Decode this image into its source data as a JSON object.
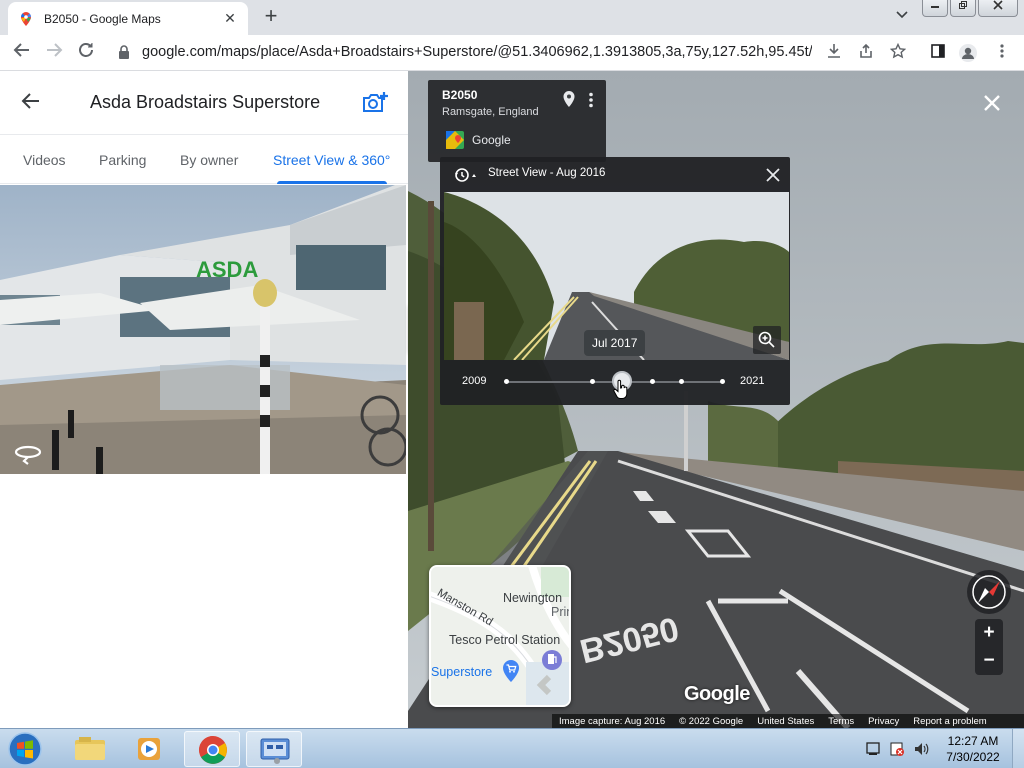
{
  "browser": {
    "tab_title": "B2050 - Google Maps",
    "tab_close": "✕",
    "new_tab": "+",
    "url": "google.com/maps/place/Asda+Broadstairs+Superstore/@51.3406962,1.3913805,3a,75y,127.52h,95.45t/dat..."
  },
  "left_panel": {
    "title": "Asda Broadstairs Superstore",
    "tabs": [
      {
        "label": "Videos"
      },
      {
        "label": "Parking"
      },
      {
        "label": "By owner"
      },
      {
        "label": "Street View & 360°"
      }
    ]
  },
  "street_view": {
    "address_card": {
      "street": "B2050",
      "city": "Ramsgate, England",
      "provider": "Google"
    },
    "time_machine": {
      "title": "Street View - Aug 2016",
      "tooltip": "Jul 2017",
      "start_year": "2009",
      "end_year": "2021"
    },
    "minimap": {
      "labels": [
        "Manston Rd",
        "Newington",
        "Prin",
        "Tesco Petrol Station",
        "Superstore"
      ]
    },
    "zoom_in": "+",
    "zoom_out": "−",
    "watermark": "Google",
    "footer": [
      "Image capture: Aug 2016",
      "© 2022 Google",
      "United States",
      "Terms",
      "Privacy",
      "Report a problem"
    ]
  },
  "taskbar": {
    "time": "12:27 AM",
    "date": "7/30/2022"
  }
}
